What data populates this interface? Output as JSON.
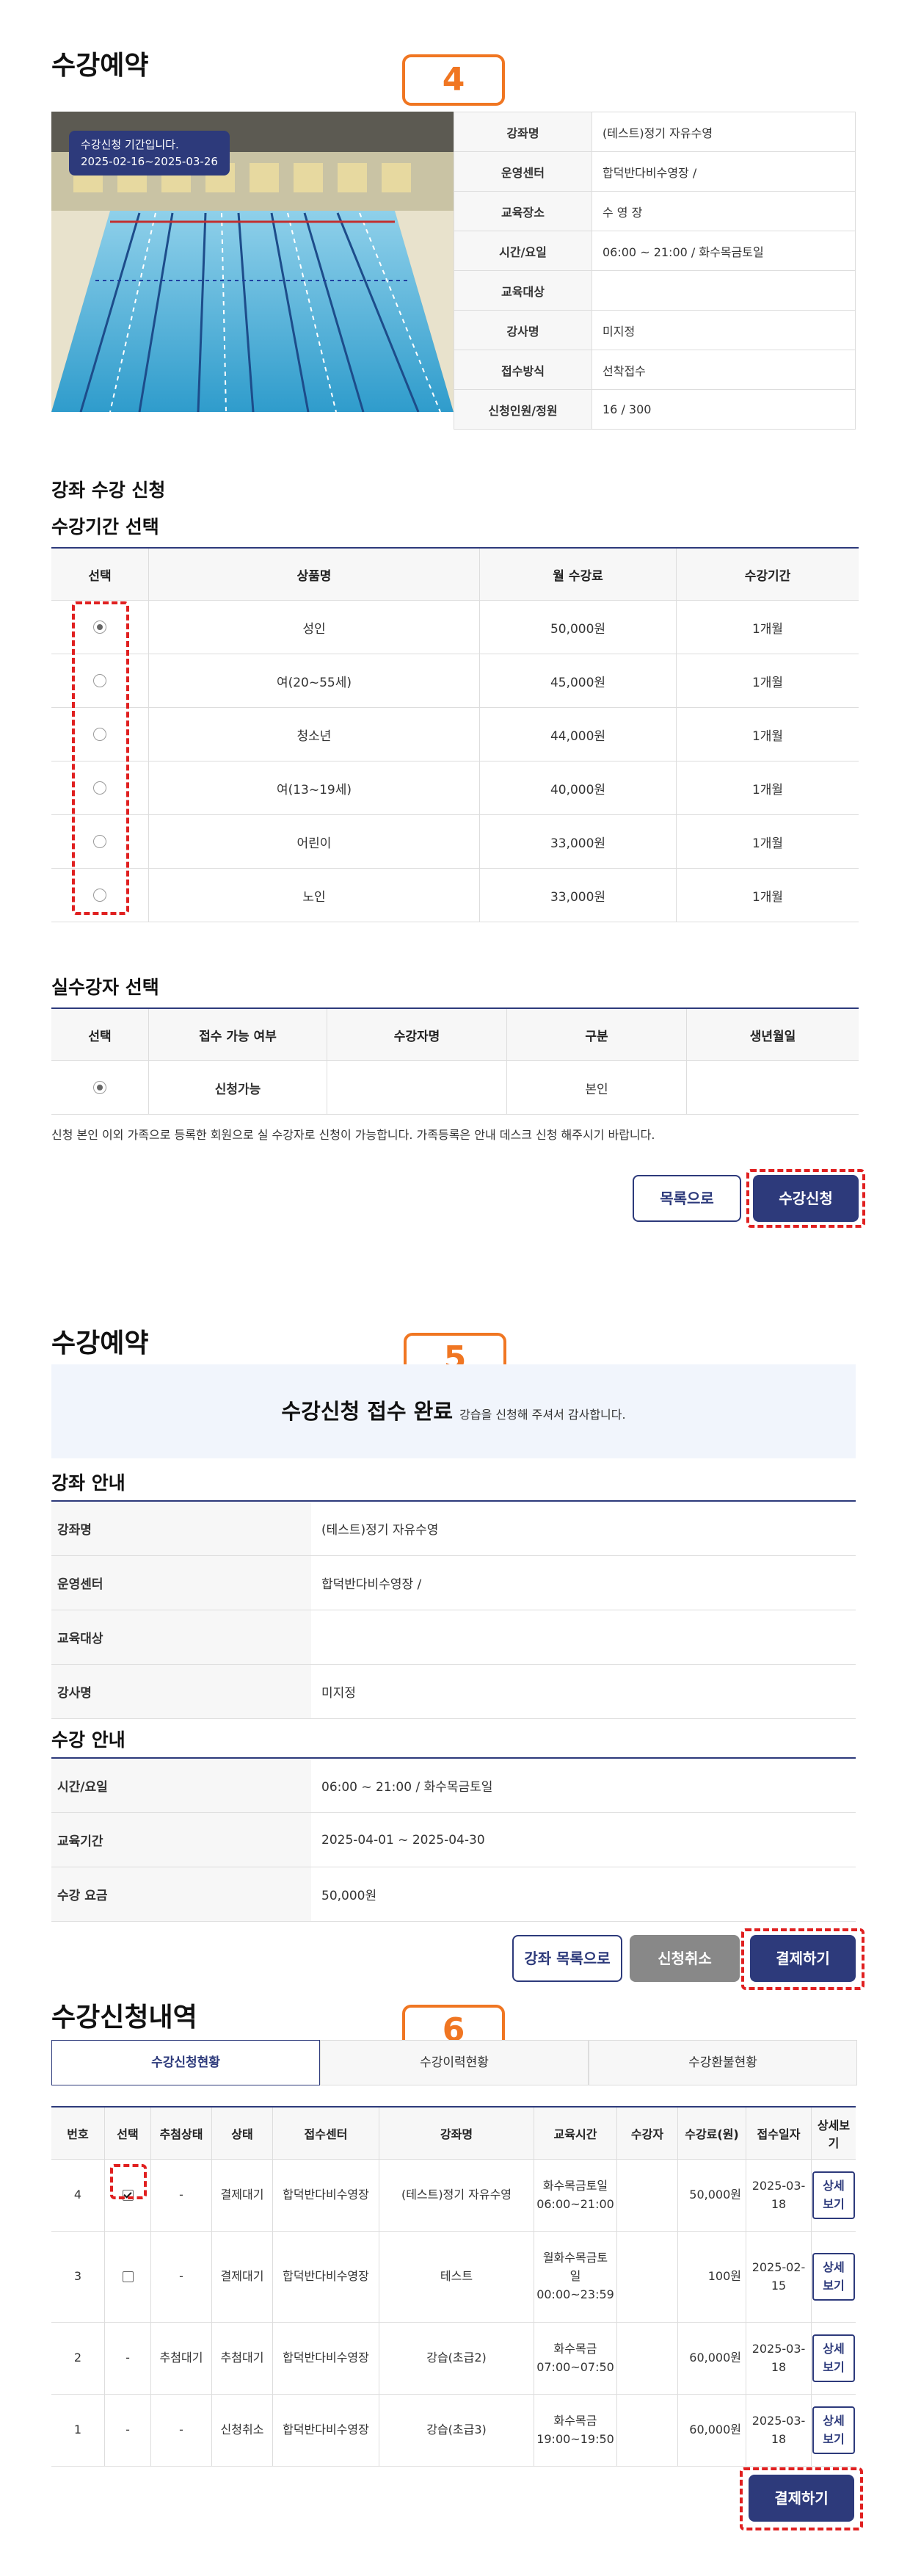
{
  "section1": {
    "title": "수강예약",
    "badge": "4",
    "image_label_line1": "수강신청 기간입니다.",
    "image_label_line2": "2025-02-16~2025-03-26",
    "info": [
      {
        "k": "강좌명",
        "v": "(테스트)정기 자유수영"
      },
      {
        "k": "운영센터",
        "v": "합덕반다비수영장 /"
      },
      {
        "k": "교육장소",
        "v": "수 영 장"
      },
      {
        "k": "시간/요일",
        "v": "06:00 ~ 21:00 / 화수목금토일"
      },
      {
        "k": "교육대상",
        "v": ""
      },
      {
        "k": "강사명",
        "v": "미지정"
      },
      {
        "k": "접수방식",
        "v": "선착접수"
      },
      {
        "k": "신청인원/정원",
        "v": "16 / 300"
      }
    ],
    "apply_heading": "강좌 수강 신청",
    "period_heading": "수강기간 선택",
    "period_headers": [
      "선택",
      "상품명",
      "월 수강료",
      "수강기간"
    ],
    "period_rows": [
      {
        "name": "성인",
        "fee": "50,000원",
        "period": "1개월",
        "selected": true
      },
      {
        "name": "여(20~55세)",
        "fee": "45,000원",
        "period": "1개월",
        "selected": false
      },
      {
        "name": "청소년",
        "fee": "44,000원",
        "period": "1개월",
        "selected": false
      },
      {
        "name": "여(13~19세)",
        "fee": "40,000원",
        "period": "1개월",
        "selected": false
      },
      {
        "name": "어린이",
        "fee": "33,000원",
        "period": "1개월",
        "selected": false
      },
      {
        "name": "노인",
        "fee": "33,000원",
        "period": "1개월",
        "selected": false
      }
    ],
    "student_heading": "실수강자 선택",
    "student_headers": [
      "선택",
      "접수 가능 여부",
      "수강자명",
      "구분",
      "생년월일"
    ],
    "student_row": {
      "status": "신청가능",
      "name": "",
      "type": "본인",
      "birth": ""
    },
    "notice": "신청 본인 이외 가족으로 등록한 회원으로 실 수강자로 신청이 가능합니다. 가족등록은 안내 데스크 신청 해주시기 바랍니다.",
    "btn_list": "목록으로",
    "btn_apply": "수강신청"
  },
  "section2": {
    "title": "수강예약",
    "badge": "5",
    "complete_main": "수강신청 접수 완료",
    "complete_sub": "강습을 신청해 주셔서 감사합니다.",
    "course_heading": "강좌 안내",
    "course": [
      {
        "k": "강좌명",
        "v": "(테스트)정기 자유수영"
      },
      {
        "k": "운영센터",
        "v": "합덕반다비수영장 /"
      },
      {
        "k": "교육대상",
        "v": ""
      },
      {
        "k": "강사명",
        "v": "미지정"
      }
    ],
    "lesson_heading": "수강 안내",
    "lesson": [
      {
        "k": "시간/요일",
        "v": "06:00 ~ 21:00 / 화수목금토일"
      },
      {
        "k": "교육기간",
        "v": "2025-04-01 ~ 2025-04-30"
      },
      {
        "k": "수강 요금",
        "v": "50,000원"
      }
    ],
    "btn_course_list": "강좌 목록으로",
    "btn_cancel": "신청취소",
    "btn_pay": "결제하기"
  },
  "section3": {
    "title": "수강신청내역",
    "badge": "6",
    "tabs": [
      "수강신청현황",
      "수강이력현황",
      "수강환불현황"
    ],
    "headers": [
      "번호",
      "선택",
      "추첨상태",
      "상태",
      "접수센터",
      "강좌명",
      "교육시간",
      "수강자",
      "수강료(원)",
      "접수일자",
      "상세보기"
    ],
    "rows": [
      {
        "no": "4",
        "select": "checkbox-checked",
        "draw": "-",
        "status": "결제대기",
        "center": "합덕반다비수영장",
        "course": "(테스트)정기 자유수영",
        "time": [
          "화수목금토일",
          "06:00~21:00"
        ],
        "student": "",
        "fee": "50,000원",
        "date": [
          "2025-03-",
          "18"
        ],
        "detail": "상세보기"
      },
      {
        "no": "3",
        "select": "checkbox",
        "draw": "-",
        "status": "결제대기",
        "center": "합덕반다비수영장",
        "course": "테스트",
        "time": [
          "월화수목금토",
          "일",
          "00:00~23:59"
        ],
        "student": "",
        "fee": "100원",
        "date": [
          "2025-02-",
          "15"
        ],
        "detail": "상세보기"
      },
      {
        "no": "2",
        "select": "-",
        "draw": "추첨대기",
        "status": "추첨대기",
        "center": "합덕반다비수영장",
        "course": "강습(초급2)",
        "time": [
          "화수목금",
          "07:00~07:50"
        ],
        "student": "",
        "fee": "60,000원",
        "date": [
          "2025-03-",
          "18"
        ],
        "detail": "상세보기"
      },
      {
        "no": "1",
        "select": "-",
        "draw": "-",
        "status": "신청취소",
        "center": "합덕반다비수영장",
        "course": "강습(초급3)",
        "time": [
          "화수목금",
          "19:00~19:50"
        ],
        "student": "",
        "fee": "60,000원",
        "date": [
          "2025-03-",
          "18"
        ],
        "detail": "상세보기"
      }
    ],
    "btn_pay": "결제하기"
  }
}
